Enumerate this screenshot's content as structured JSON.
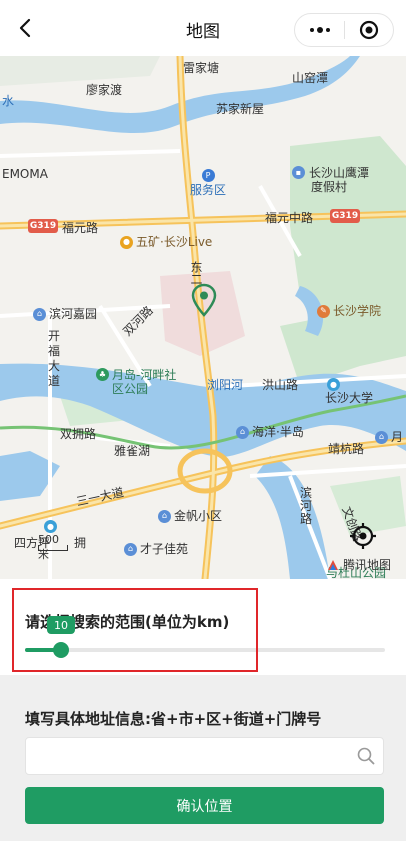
{
  "nav": {
    "title": "地图"
  },
  "map": {
    "labels": {
      "leijiatang": "雷家塘",
      "liaojiadu": "廖家渡",
      "shanwotan": "山窑潭",
      "sujiaxinwu": "苏家新屋",
      "water": "水",
      "emoma": "EMOMA",
      "fuwuqu": "服务区",
      "yingtan": "长沙山鹰潭",
      "dujiacun": "度假村",
      "g319a": "G319",
      "fuyuanlu": "福元路",
      "wukuang": "五矿·长沙Live",
      "fuyuanzhonglu": "福元中路",
      "g319b": "G319",
      "binhejiayuan": "滨河嘉园",
      "shuanghelu": "双河路",
      "changshaxueyuan": "长沙学院",
      "kaifu": "开福大道",
      "yuedao": "月岛-河畔社区公园",
      "liuyanghe": "浏阳河",
      "hongshanlu": "洪山路",
      "changshadaxue": "长沙大学",
      "shuangyonglu": "双拥路",
      "haiyang": "海洋·半岛",
      "yue": "月",
      "yaquehu": "雅雀湖",
      "jinghanglu": "靖杭路",
      "sanyidao": "三一大道",
      "binhelu": "滨河路",
      "jinfan": "金帆小区",
      "wenchanglu": "文创路",
      "sifangping": "四方坪",
      "caizi": "才子佳苑",
      "yushan": "与杜山公园",
      "yongdao": "拥",
      "dong": "东二"
    },
    "scale_text": "500米",
    "logo_text": "腾讯地图"
  },
  "range": {
    "label": "请选择搜索的范围(单位为km)",
    "value": 10,
    "value_label": "10",
    "max": 100
  },
  "address": {
    "label": "填写具体地址信息:省+市+区+街道+门牌号",
    "input_value": "",
    "input_placeholder": ""
  },
  "confirm": {
    "label": "确认位置"
  },
  "colors": {
    "accent": "#1f9c63",
    "highlight": "#e0262a",
    "map_bg": "#f3f2ee",
    "water": "#9cc9ec",
    "green_area": "#cfe7cf",
    "road_major": "#f6c35b"
  }
}
